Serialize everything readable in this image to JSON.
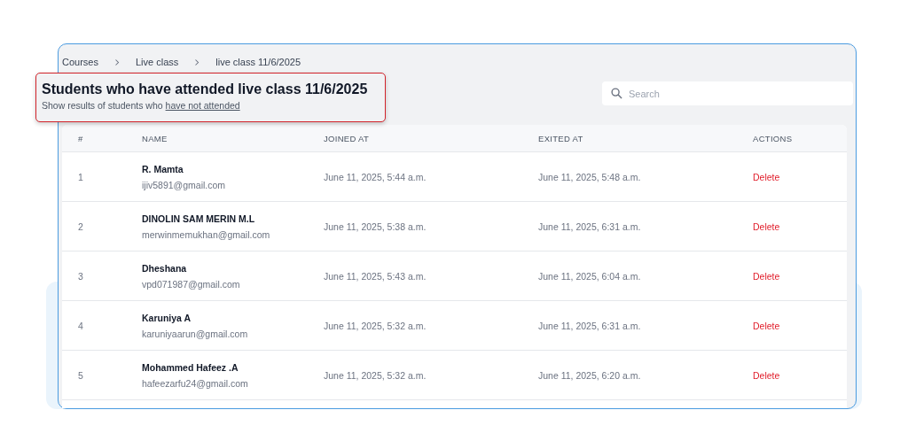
{
  "breadcrumb": [
    "Courses",
    "Live class",
    "live class 11/6/2025"
  ],
  "heading": {
    "title": "Students who have attended live class 11/6/2025",
    "subtitle": "Show results of students who",
    "link": "have not attended"
  },
  "search": {
    "placeholder": "Search"
  },
  "table": {
    "columns": [
      "#",
      "NAME",
      "JOINED AT",
      "EXITED AT",
      "ACTIONS"
    ],
    "rows": [
      {
        "index": "1",
        "name": "R. Mamta",
        "email": "ijiv5891@gmail.com",
        "joined": "June 11, 2025, 5:44 a.m.",
        "exited": "June 11, 2025, 5:48 a.m.",
        "action": "Delete"
      },
      {
        "index": "2",
        "name": "DINOLIN SAM MERIN M.L",
        "email": "merwinmemukhan@gmail.com",
        "joined": "June 11, 2025, 5:38 a.m.",
        "exited": "June 11, 2025, 6:31 a.m.",
        "action": "Delete"
      },
      {
        "index": "3",
        "name": "Dheshana",
        "email": "vpd071987@gmail.com",
        "joined": "June 11, 2025, 5:43 a.m.",
        "exited": "June 11, 2025, 6:04 a.m.",
        "action": "Delete"
      },
      {
        "index": "4",
        "name": "Karuniya A",
        "email": "karuniyaarun@gmail.com",
        "joined": "June 11, 2025, 5:32 a.m.",
        "exited": "June 11, 2025, 6:31 a.m.",
        "action": "Delete"
      },
      {
        "index": "5",
        "name": "Mohammed Hafeez .A",
        "email": "hafeezarfu24@gmail.com",
        "joined": "June 11, 2025, 5:32 a.m.",
        "exited": "June 11, 2025, 6:20 a.m.",
        "action": "Delete"
      }
    ]
  }
}
